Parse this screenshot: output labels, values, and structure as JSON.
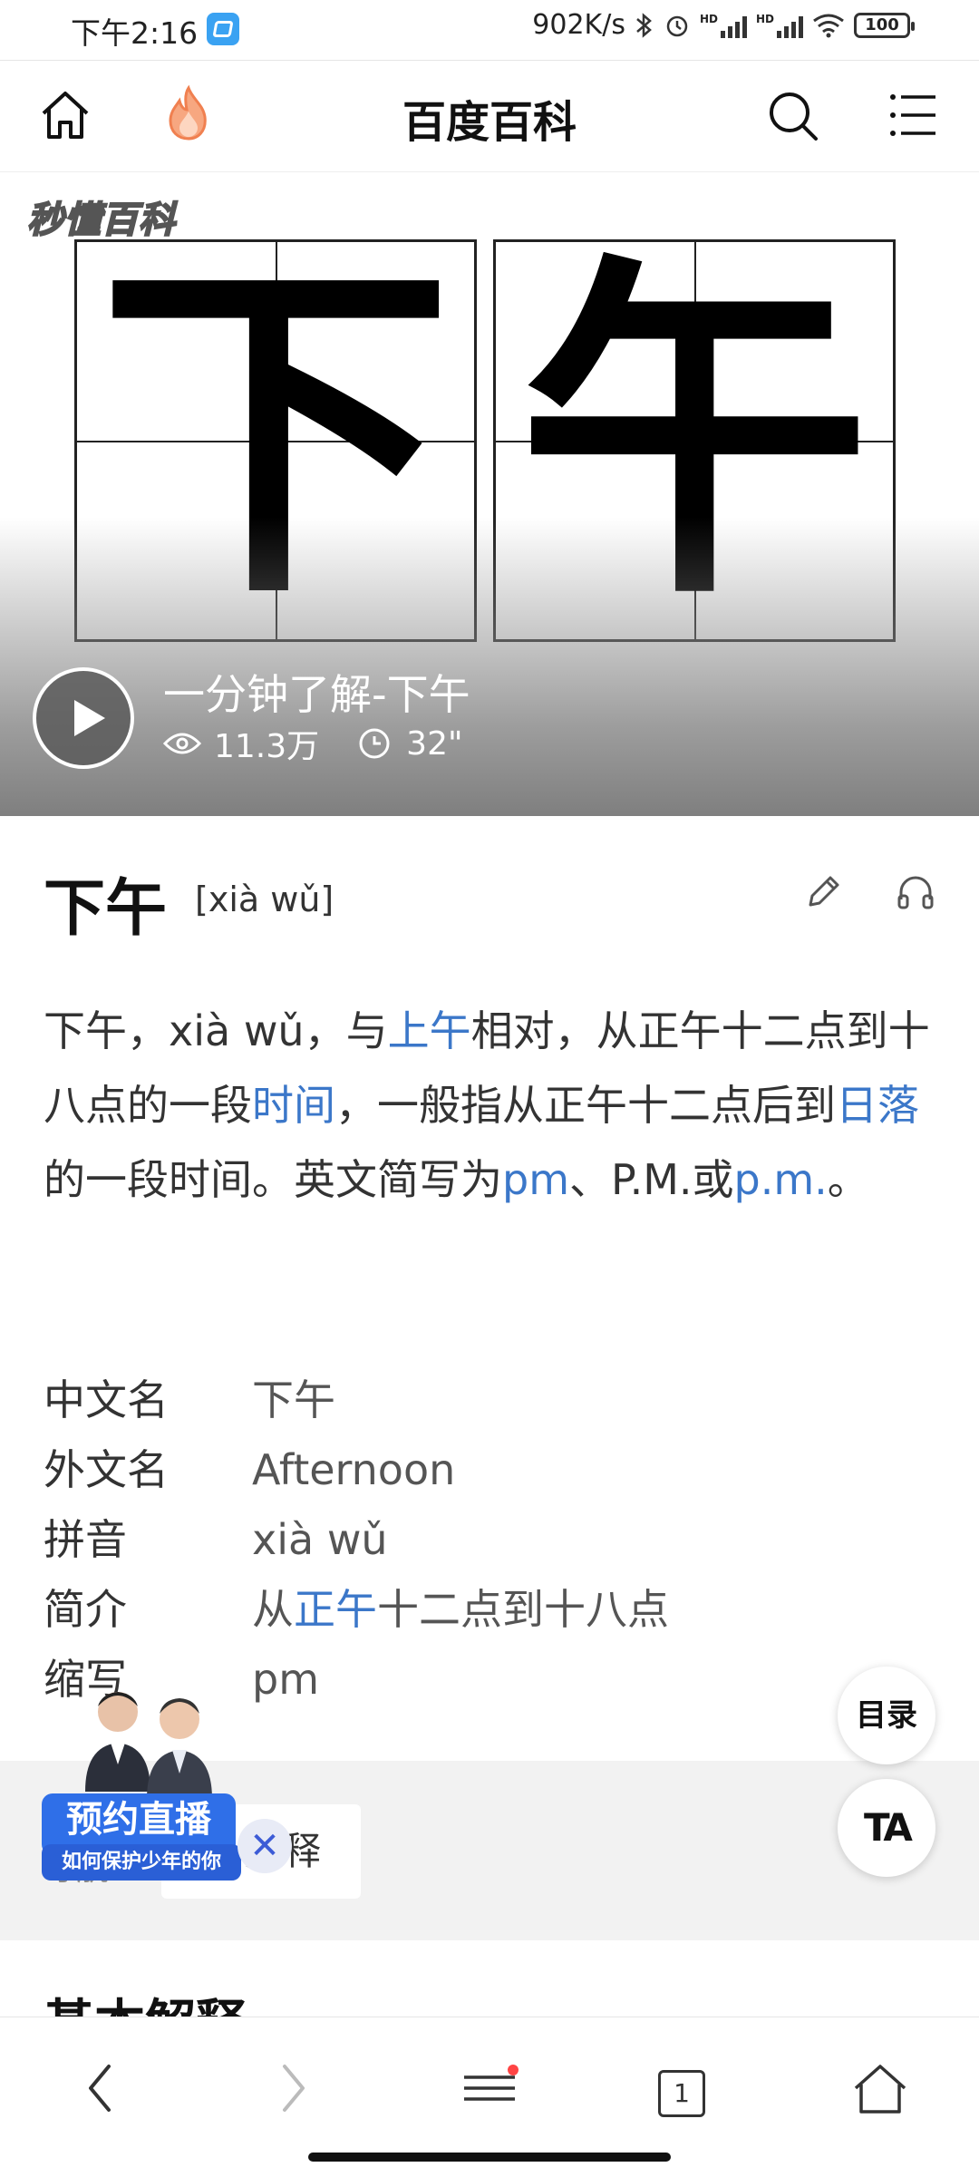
{
  "status_bar": {
    "time": "下午2:16",
    "net_speed": "902K/s",
    "battery": "100",
    "hd1": "HD",
    "hd2": "HD"
  },
  "header": {
    "title": "百度百科",
    "icons": [
      "home-icon",
      "hot-fire-icon",
      "search-icon",
      "menu-icon"
    ]
  },
  "video": {
    "brand": "秒懂百科",
    "characters": [
      "下",
      "午"
    ],
    "title": "一分钟了解-下午",
    "views": "11.3万",
    "duration": "32\""
  },
  "entry": {
    "title": "下午",
    "pinyin": "[xià wǔ]"
  },
  "summary": {
    "t1": "下午，xià wǔ，与",
    "l1": "上午",
    "t2": "相对，从正午十二点到十八点的一段",
    "l2": "时间",
    "t3": "，一般指从正午十二点后到",
    "l3": "日落",
    "t4": "的一段时间。英文简写为",
    "l4": "pm",
    "t5": "、P.M.或",
    "l5": "p.m.",
    "t6": "。"
  },
  "basic_info": [
    {
      "key": "中文名",
      "value": "下午"
    },
    {
      "key": "外文名",
      "value": "Afternoon"
    },
    {
      "key": "拼音",
      "value": "xià wǔ"
    },
    {
      "key": "简介",
      "value_pre": "从",
      "value_link": "正午",
      "value_post": "十二点到十八点"
    },
    {
      "key": "缩写",
      "value": "pm"
    }
  ],
  "nav_band": {
    "side_label_1": "快",
    "side_label_2": "导航",
    "card_label": "解释"
  },
  "promo": {
    "banner": "预约直播",
    "subtitle": "如何保护少年的你",
    "close": "✕"
  },
  "fab": {
    "toc": "目录",
    "font": "TA"
  },
  "next_heading": "基本解释",
  "bottom_nav": {
    "tab_count": "1"
  },
  "colors": {
    "link": "#3b77c9",
    "accent_fire": "#f5895a",
    "promo_blue": "#2f6fe8"
  }
}
